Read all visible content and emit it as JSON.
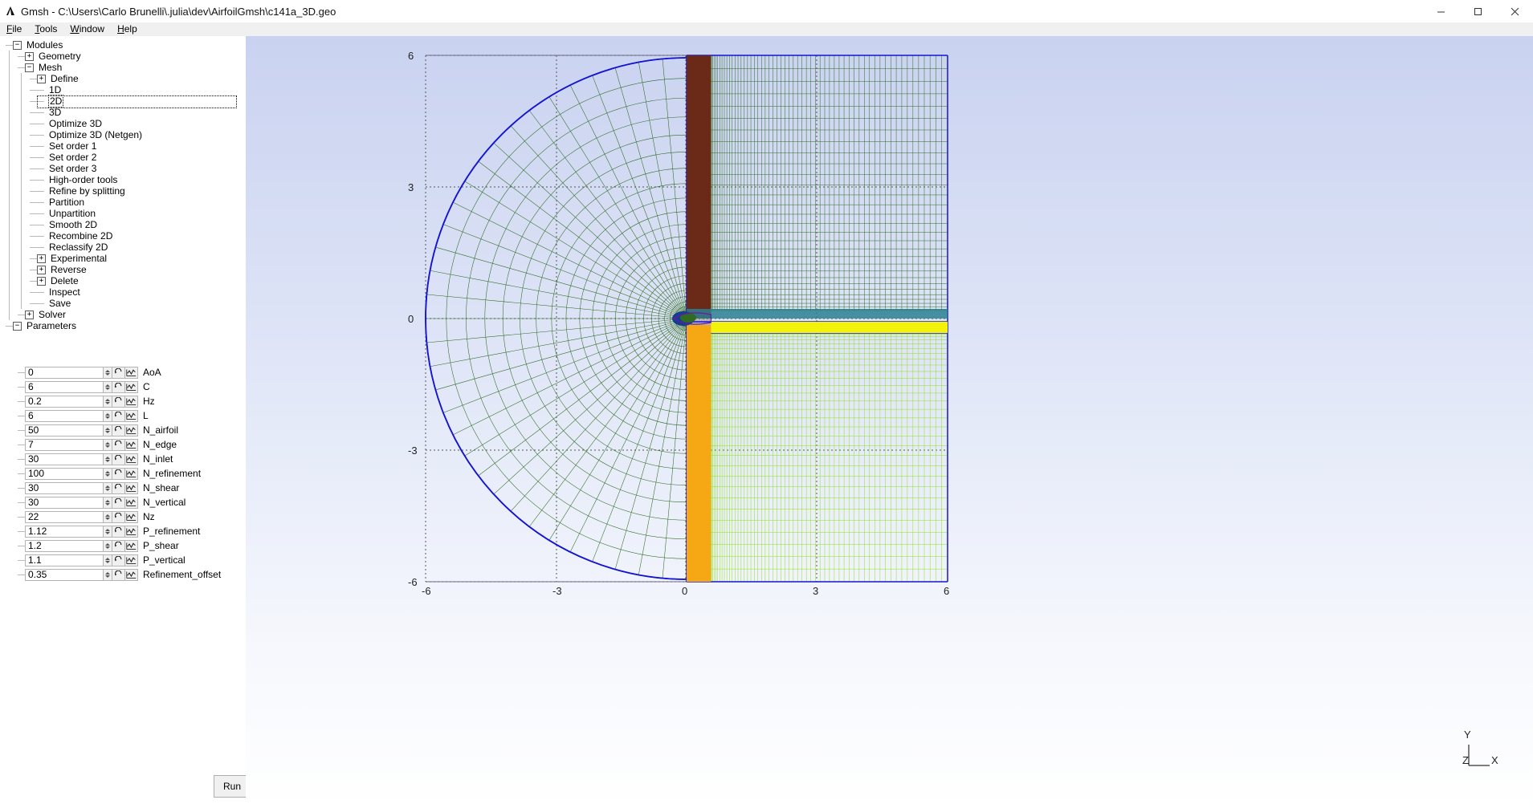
{
  "window": {
    "title": "Gmsh - C:\\Users\\Carlo Brunelli\\.julia\\dev\\AirfoilGmsh\\c141a_3D.geo",
    "app_icon": "gmsh-icon",
    "minimize": "─",
    "maximize": "□",
    "close": "✕"
  },
  "menubar": {
    "items": [
      {
        "label": "File",
        "mnemonic": "F",
        "rest": "ile"
      },
      {
        "label": "Tools",
        "mnemonic": "T",
        "rest": "ools"
      },
      {
        "label": "Window",
        "mnemonic": "W",
        "rest": "indow"
      },
      {
        "label": "Help",
        "mnemonic": "H",
        "rest": "elp"
      }
    ]
  },
  "tree": {
    "nodes": [
      {
        "label": "Modules",
        "depth": 0,
        "toggle": "minus",
        "selected": false
      },
      {
        "label": "Geometry",
        "depth": 1,
        "toggle": "plus",
        "selected": false
      },
      {
        "label": "Mesh",
        "depth": 1,
        "toggle": "minus",
        "selected": false
      },
      {
        "label": "Define",
        "depth": 2,
        "toggle": "plus",
        "selected": false
      },
      {
        "label": "1D",
        "depth": 2,
        "toggle": "leaf",
        "selected": false
      },
      {
        "label": "2D",
        "depth": 2,
        "toggle": "leaf",
        "selected": true
      },
      {
        "label": "3D",
        "depth": 2,
        "toggle": "leaf",
        "selected": false
      },
      {
        "label": "Optimize 3D",
        "depth": 2,
        "toggle": "leaf",
        "selected": false
      },
      {
        "label": "Optimize 3D (Netgen)",
        "depth": 2,
        "toggle": "leaf",
        "selected": false
      },
      {
        "label": "Set order 1",
        "depth": 2,
        "toggle": "leaf",
        "selected": false
      },
      {
        "label": "Set order 2",
        "depth": 2,
        "toggle": "leaf",
        "selected": false
      },
      {
        "label": "Set order 3",
        "depth": 2,
        "toggle": "leaf",
        "selected": false
      },
      {
        "label": "High-order tools",
        "depth": 2,
        "toggle": "leaf",
        "selected": false
      },
      {
        "label": "Refine by splitting",
        "depth": 2,
        "toggle": "leaf",
        "selected": false
      },
      {
        "label": "Partition",
        "depth": 2,
        "toggle": "leaf",
        "selected": false
      },
      {
        "label": "Unpartition",
        "depth": 2,
        "toggle": "leaf",
        "selected": false
      },
      {
        "label": "Smooth 2D",
        "depth": 2,
        "toggle": "leaf",
        "selected": false
      },
      {
        "label": "Recombine 2D",
        "depth": 2,
        "toggle": "leaf",
        "selected": false
      },
      {
        "label": "Reclassify 2D",
        "depth": 2,
        "toggle": "leaf",
        "selected": false
      },
      {
        "label": "Experimental",
        "depth": 2,
        "toggle": "plus",
        "selected": false
      },
      {
        "label": "Reverse",
        "depth": 2,
        "toggle": "plus",
        "selected": false
      },
      {
        "label": "Delete",
        "depth": 2,
        "toggle": "plus",
        "selected": false
      },
      {
        "label": "Inspect",
        "depth": 2,
        "toggle": "leaf",
        "selected": false
      },
      {
        "label": "Save",
        "depth": 2,
        "toggle": "leaf",
        "selected": false
      },
      {
        "label": "Solver",
        "depth": 1,
        "toggle": "plus",
        "selected": false
      },
      {
        "label": "Parameters",
        "depth": 0,
        "toggle": "minus",
        "selected": false
      }
    ]
  },
  "parameters": {
    "rows": [
      {
        "value": "0",
        "label": "AoA"
      },
      {
        "value": "6",
        "label": "C"
      },
      {
        "value": "0.2",
        "label": "Hz"
      },
      {
        "value": "6",
        "label": "L"
      },
      {
        "value": "50",
        "label": "N_airfoil"
      },
      {
        "value": "7",
        "label": "N_edge"
      },
      {
        "value": "30",
        "label": "N_inlet"
      },
      {
        "value": "100",
        "label": "N_refinement"
      },
      {
        "value": "30",
        "label": "N_shear"
      },
      {
        "value": "30",
        "label": "N_vertical"
      },
      {
        "value": "22",
        "label": "Nz"
      },
      {
        "value": "1.12",
        "label": "P_refinement"
      },
      {
        "value": "1.2",
        "label": "P_shear"
      },
      {
        "value": "1.1",
        "label": "P_vertical"
      },
      {
        "value": "0.35",
        "label": "Refinement_offset"
      }
    ],
    "reload_icon": "reload-icon",
    "plot_icon": "plot-icon",
    "spinner_icon": "spinner-icon"
  },
  "toolbar": {
    "run_label": "Run",
    "gear_icon": "gear-icon",
    "gear_dropdown_icon": "chevron-down-icon"
  },
  "viewport": {
    "x_ticks": [
      "-6",
      "-3",
      "0",
      "3",
      "6"
    ],
    "y_ticks": [
      "6",
      "3",
      "0",
      "-3",
      "-6"
    ],
    "orientation": {
      "y": "Y",
      "z": "Z",
      "x": "X"
    },
    "colors": {
      "background_top": "#c9d2f0",
      "background_bottom": "#ffffff",
      "mesh_green": "#2f6b22",
      "mesh_lime": "#8fe018",
      "outline_blue": "#1414d2",
      "zone_orange": "#f5a813",
      "zone_yellow": "#f2f20a",
      "zone_dark_red": "#6b2a18",
      "zone_teal": "#2a8090"
    }
  }
}
